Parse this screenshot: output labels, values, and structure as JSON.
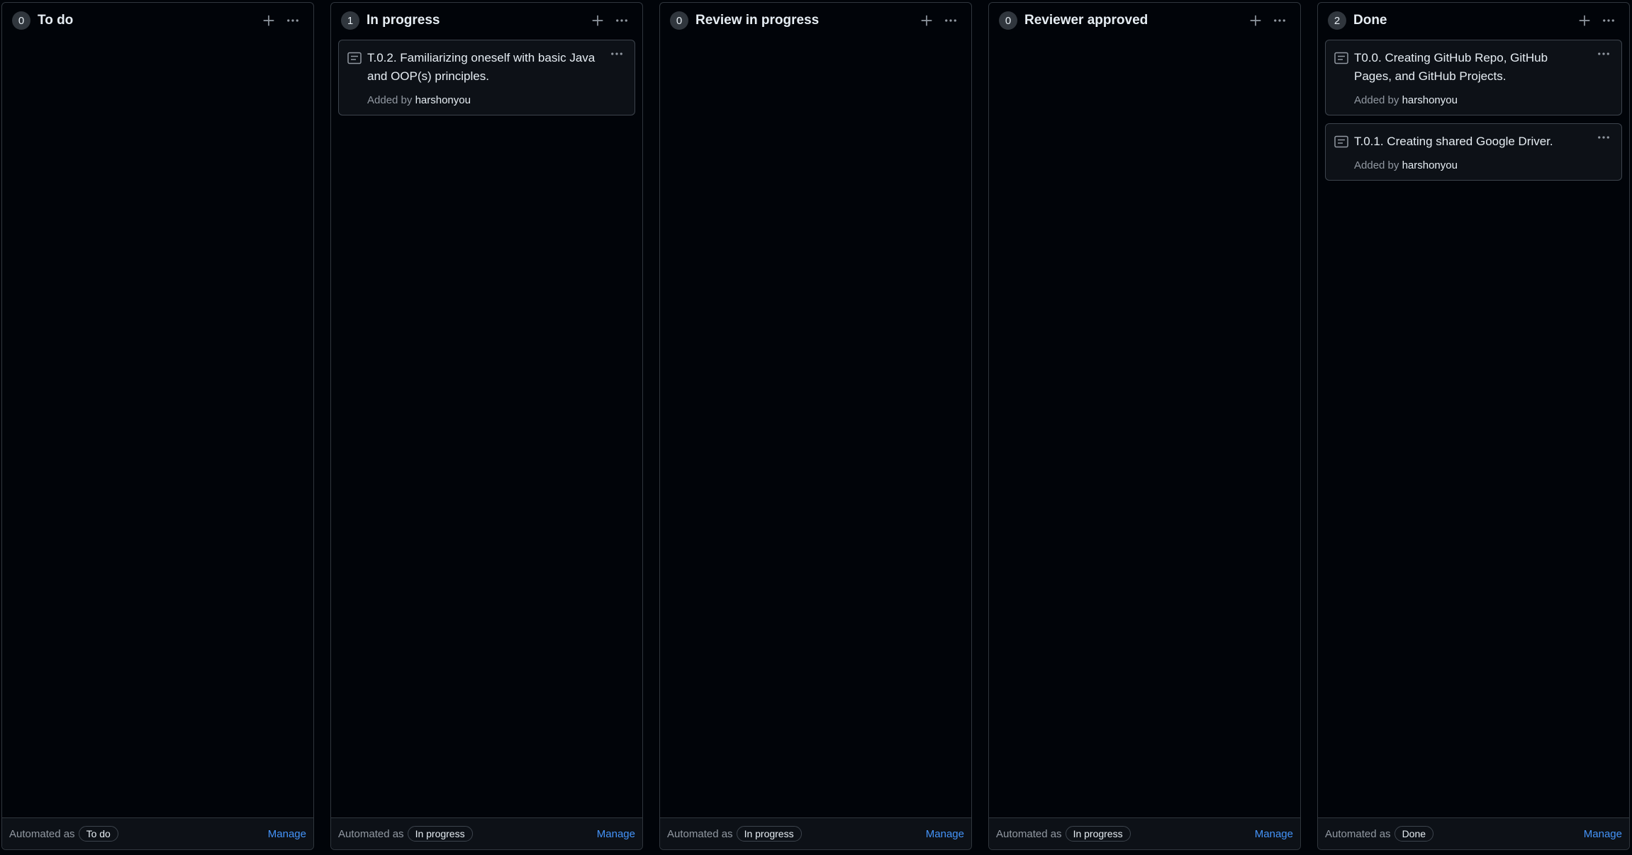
{
  "columns": [
    {
      "count": "0",
      "title": "To do",
      "footer": {
        "automated_label": "Automated as",
        "automation": "To do",
        "manage": "Manage"
      },
      "cards": []
    },
    {
      "count": "1",
      "title": "In progress",
      "footer": {
        "automated_label": "Automated as",
        "automation": "In progress",
        "manage": "Manage"
      },
      "cards": [
        {
          "title": "T.0.2. Familiarizing oneself with basic Java and OOP(s) principles.",
          "added_by_label": "Added by",
          "author": "harshonyou"
        }
      ]
    },
    {
      "count": "0",
      "title": "Review in progress",
      "footer": {
        "automated_label": "Automated as",
        "automation": "In progress",
        "manage": "Manage"
      },
      "cards": []
    },
    {
      "count": "0",
      "title": "Reviewer approved",
      "footer": {
        "automated_label": "Automated as",
        "automation": "In progress",
        "manage": "Manage"
      },
      "cards": []
    },
    {
      "count": "2",
      "title": "Done",
      "footer": {
        "automated_label": "Automated as",
        "automation": "Done",
        "manage": "Manage"
      },
      "cards": [
        {
          "title": "T0.0. Creating GitHub Repo, GitHub Pages, and GitHub Projects.",
          "added_by_label": "Added by",
          "author": "harshonyou"
        },
        {
          "title": "T.0.1. Creating shared Google Driver.",
          "added_by_label": "Added by",
          "author": "harshonyou"
        }
      ]
    }
  ],
  "icons": {
    "add": "plus-icon",
    "menu": "kebab-horizontal-icon",
    "card": "note-icon"
  },
  "colors": {
    "background": "#010409",
    "border": "#30363d",
    "link": "#4493f8"
  }
}
